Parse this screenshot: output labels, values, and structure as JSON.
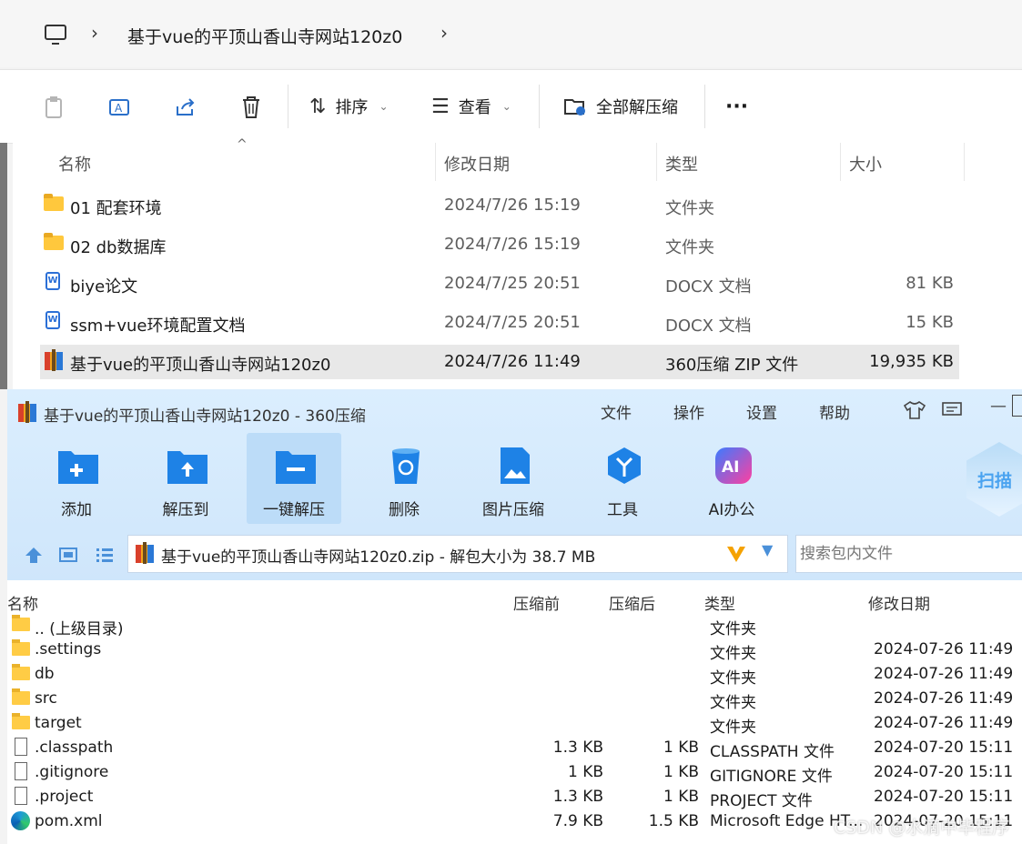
{
  "explorer": {
    "breadcrumb": [
      "基于vue的平顶山香山寺网站120z0"
    ],
    "toolbar": {
      "sort_label": "排序",
      "view_label": "查看",
      "extract_all_label": "全部解压缩",
      "more_label": "···"
    },
    "columns": [
      "名称",
      "修改日期",
      "类型",
      "大小"
    ],
    "files": [
      {
        "name": "01 配套环境",
        "date": "2024/7/26 15:19",
        "type": "文件夹",
        "size": "",
        "icon": "folder-icon"
      },
      {
        "name": "02 db数据库",
        "date": "2024/7/26 15:19",
        "type": "文件夹",
        "size": "",
        "icon": "folder-icon"
      },
      {
        "name": "biye论文",
        "date": "2024/7/25 20:51",
        "type": "DOCX 文档",
        "size": "81 KB",
        "icon": "docx-icon"
      },
      {
        "name": "ssm+vue环境配置文档",
        "date": "2024/7/25 20:51",
        "type": "DOCX 文档",
        "size": "15 KB",
        "icon": "docx-icon"
      },
      {
        "name": "基于vue的平顶山香山寺网站120z0",
        "date": "2024/7/26 11:49",
        "type": "360压缩 ZIP 文件",
        "size": "19,935 KB",
        "icon": "zip-icon",
        "selected": true
      }
    ]
  },
  "zip_window": {
    "title": "基于vue的平顶山香山寺网站120z0 - 360压缩",
    "menu": [
      "文件",
      "操作",
      "设置",
      "帮助"
    ],
    "minimize": "—",
    "buttons": [
      "添加",
      "解压到",
      "一键解压",
      "删除",
      "图片压缩",
      "工具",
      "AI办公"
    ],
    "scan_label": "扫描",
    "path_text": "基于vue的平顶山香山寺网站120z0.zip - 解包大小为 38.7 MB",
    "search_placeholder": "搜索包内文件",
    "columns": [
      "名称",
      "压缩前",
      "压缩后",
      "类型",
      "修改日期"
    ],
    "rows": [
      {
        "name": ".. (上级目录)",
        "before": "",
        "after": "",
        "type": "文件夹",
        "date": "",
        "icon": "folder"
      },
      {
        "name": ".settings",
        "before": "",
        "after": "",
        "type": "文件夹",
        "date": "2024-07-26 11:49",
        "icon": "folder"
      },
      {
        "name": "db",
        "before": "",
        "after": "",
        "type": "文件夹",
        "date": "2024-07-26 11:49",
        "icon": "folder"
      },
      {
        "name": "src",
        "before": "",
        "after": "",
        "type": "文件夹",
        "date": "2024-07-26 11:49",
        "icon": "folder"
      },
      {
        "name": "target",
        "before": "",
        "after": "",
        "type": "文件夹",
        "date": "2024-07-26 11:49",
        "icon": "folder"
      },
      {
        "name": ".classpath",
        "before": "1.3 KB",
        "after": "1 KB",
        "type": "CLASSPATH 文件",
        "date": "2024-07-20 15:11",
        "icon": "file"
      },
      {
        "name": ".gitignore",
        "before": "1 KB",
        "after": "1 KB",
        "type": "GITIGNORE 文件",
        "date": "2024-07-20 15:11",
        "icon": "file"
      },
      {
        "name": ".project",
        "before": "1.3 KB",
        "after": "1 KB",
        "type": "PROJECT 文件",
        "date": "2024-07-20 15:11",
        "icon": "file"
      },
      {
        "name": "pom.xml",
        "before": "7.9 KB",
        "after": "1.5 KB",
        "type": "Microsoft Edge HT...",
        "date": "2024-07-20 15:11",
        "icon": "edge"
      }
    ]
  },
  "watermark": "CSDN @水滴中毕程序"
}
